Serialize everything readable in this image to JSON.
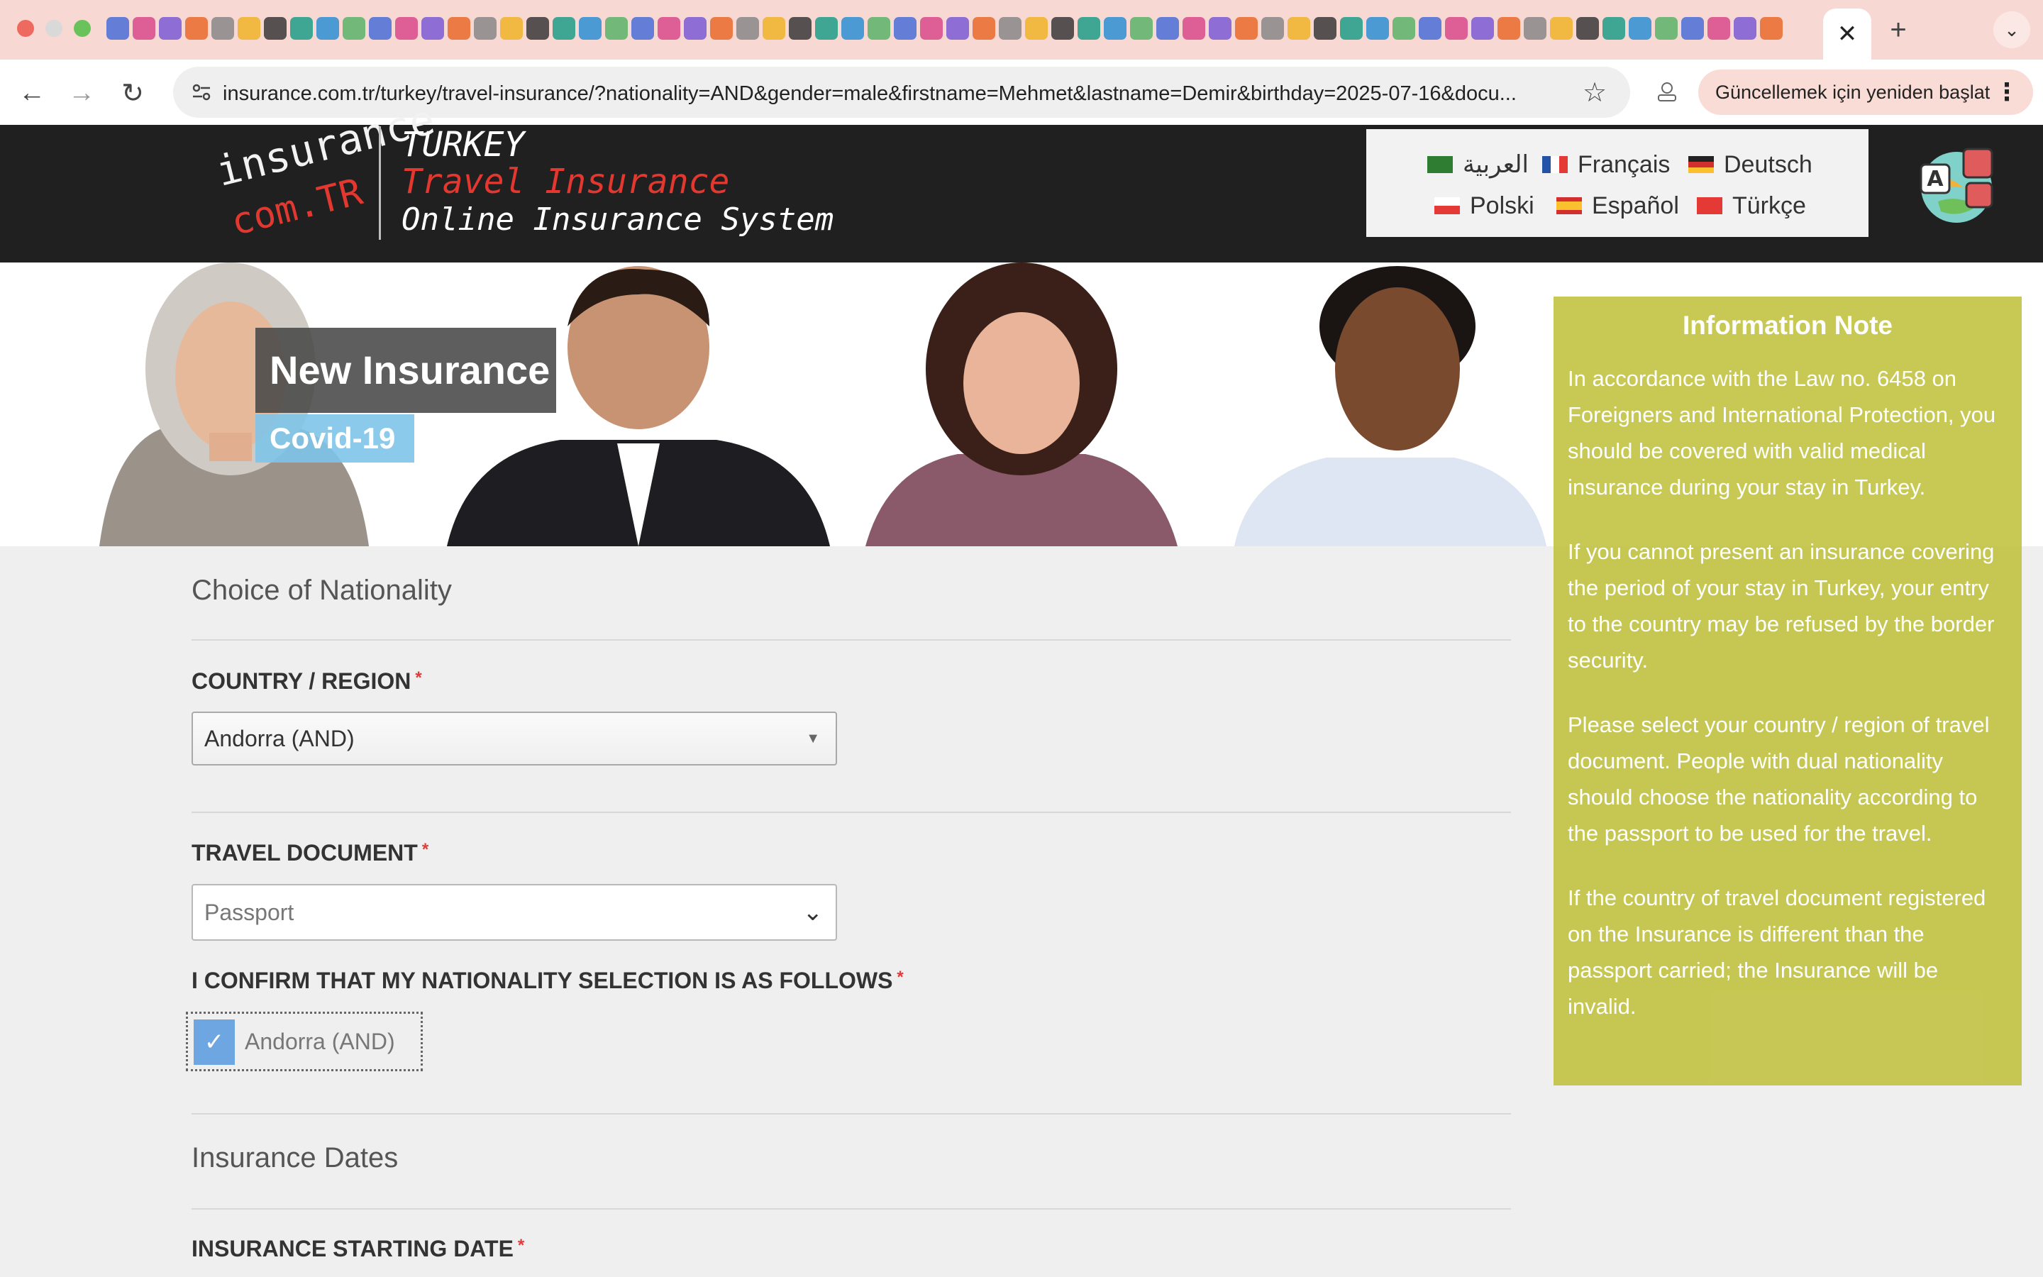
{
  "browser": {
    "active_tab_close": "✕",
    "new_tab": "+",
    "tab_search": "⌄",
    "back": "←",
    "forward": "→",
    "reload": "↻",
    "url": "insurance.com.tr/turkey/travel-insurance/?nationality=AND&gender=male&firstname=Mehmet&lastname=Demir&birthday=2025-07-16&docu...",
    "bookmark_icon": "☆",
    "restart_label": "Güncellemek için yeniden başlat",
    "menu_icon": "⋮"
  },
  "header": {
    "logo_line1": "insurance",
    "logo_line2": "com.TR",
    "tagline1": "TURKEY",
    "tagline2": "Travel Insurance",
    "tagline3": "Online Insurance System",
    "languages": [
      {
        "label": "العربية",
        "flag_colors": [
          "#2e7d32",
          "#ffffff"
        ]
      },
      {
        "label": "Français",
        "flag_colors": [
          "#2352a6",
          "#ffffff",
          "#e53935"
        ]
      },
      {
        "label": "Deutsch",
        "flag_colors": [
          "#222222",
          "#d32f2f",
          "#fbc02d"
        ]
      },
      {
        "label": "Polski",
        "flag_colors": [
          "#ffffff",
          "#e53935"
        ]
      },
      {
        "label": "Español",
        "flag_colors": [
          "#d32f2f",
          "#fbc02d",
          "#d32f2f"
        ]
      },
      {
        "label": "Türkçe",
        "flag_colors": [
          "#e53935"
        ]
      }
    ]
  },
  "hero": {
    "title": "New Insurance",
    "subtitle": "Covid-19"
  },
  "info_note": {
    "title": "Information Note",
    "paragraphs": [
      "In accordance with the Law no. 6458 on Foreigners and International Protection, you should be covered with valid medical insurance during your stay in Turkey.",
      "If you cannot present an insurance covering the period of your stay in Turkey, your entry to the country may be refused by the border security.",
      "Please select your country / region of travel document. People with dual nationality should choose the nationality according to the passport to be used for the travel.",
      "If the country of travel document registered on the Insurance is different than the passport carried; the Insurance will be invalid."
    ]
  },
  "form": {
    "section1_title": "Choice of Nationality",
    "country_label": "COUNTRY / REGION",
    "country_value": "Andorra (AND)",
    "doc_label": "TRAVEL DOCUMENT",
    "doc_value": "Passport",
    "confirm_label": "I CONFIRM THAT MY NATIONALITY SELECTION IS AS FOLLOWS",
    "confirm_value": "Andorra (AND)",
    "section2_title": "Insurance Dates",
    "start_date_label": "INSURANCE STARTING DATE",
    "required_mark": "*"
  },
  "colors": {
    "header_bg": "#202020",
    "accent_red": "#e3382f",
    "info_bg": "#c0c23e",
    "check_blue": "#6ea6e2",
    "hero_sub_bg": "#7ec4e9"
  }
}
